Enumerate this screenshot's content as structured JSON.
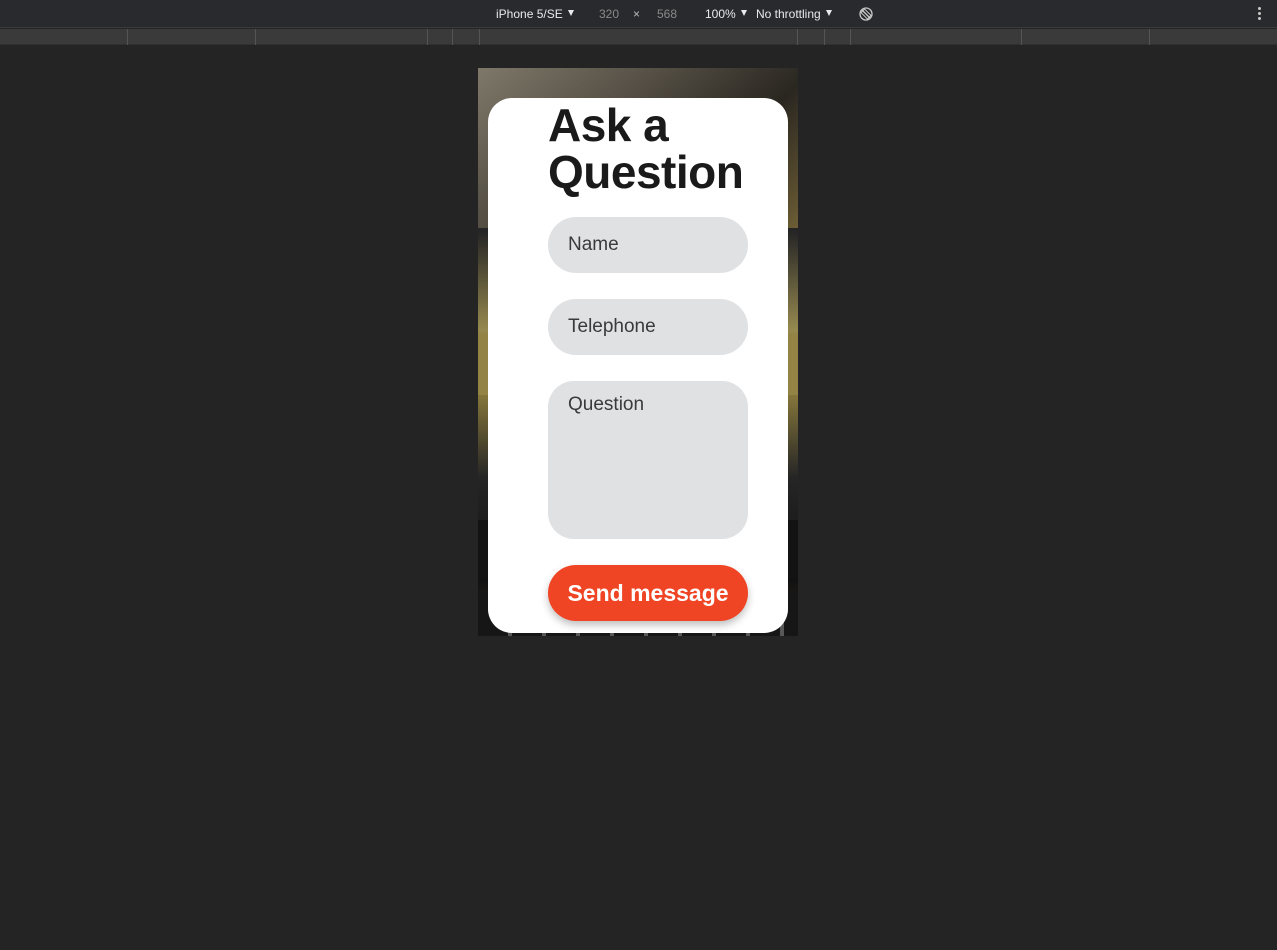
{
  "devtools": {
    "device": "iPhone 5/SE",
    "width": "320",
    "times": "×",
    "height": "568",
    "zoom": "100%",
    "throttling": "No throttling",
    "icons": [
      "rotate-icon",
      "kebab-menu-icon"
    ]
  },
  "form": {
    "title": "Ask a Question",
    "name_placeholder": "Name",
    "telephone_placeholder": "Telephone",
    "question_placeholder": "Question",
    "submit_label": "Send message"
  },
  "colors": {
    "accent": "#ef4524",
    "field_bg": "#e0e1e3",
    "devtools_bg": "#292a2d",
    "canvas_bg": "#242424"
  }
}
